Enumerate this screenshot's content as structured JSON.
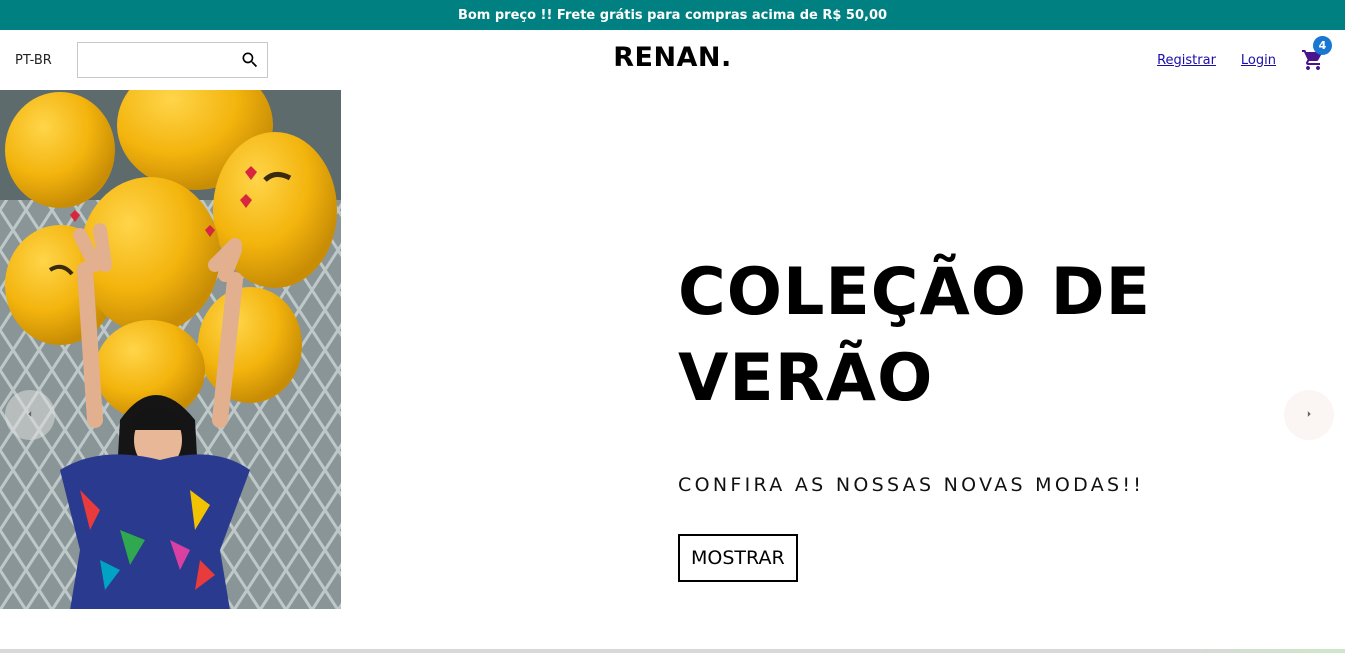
{
  "announcement": {
    "text": "Bom preço !! Frete grátis para compras acima de R$ 50,00",
    "bg_color": "#008080"
  },
  "navbar": {
    "language": "PT-BR",
    "search": {
      "value": "",
      "placeholder": "",
      "icon": "search-icon"
    },
    "logo": "RENAN.",
    "links": {
      "register": "Registrar",
      "login": "Login"
    },
    "cart": {
      "icon": "shopping-cart-icon",
      "badge_count": "4",
      "badge_color": "#1976d2"
    }
  },
  "hero": {
    "image": "woman-with-yellow-emoji-balloons",
    "title_line1": "COLEÇÃO DE",
    "title_line2": "VERÃO",
    "description": "CONFIRA AS NOSSAS NOVAS MODAS!!",
    "button_label": "MOSTRAR",
    "arrows": {
      "left": "arrow-left-icon",
      "right": "arrow-right-icon"
    }
  }
}
